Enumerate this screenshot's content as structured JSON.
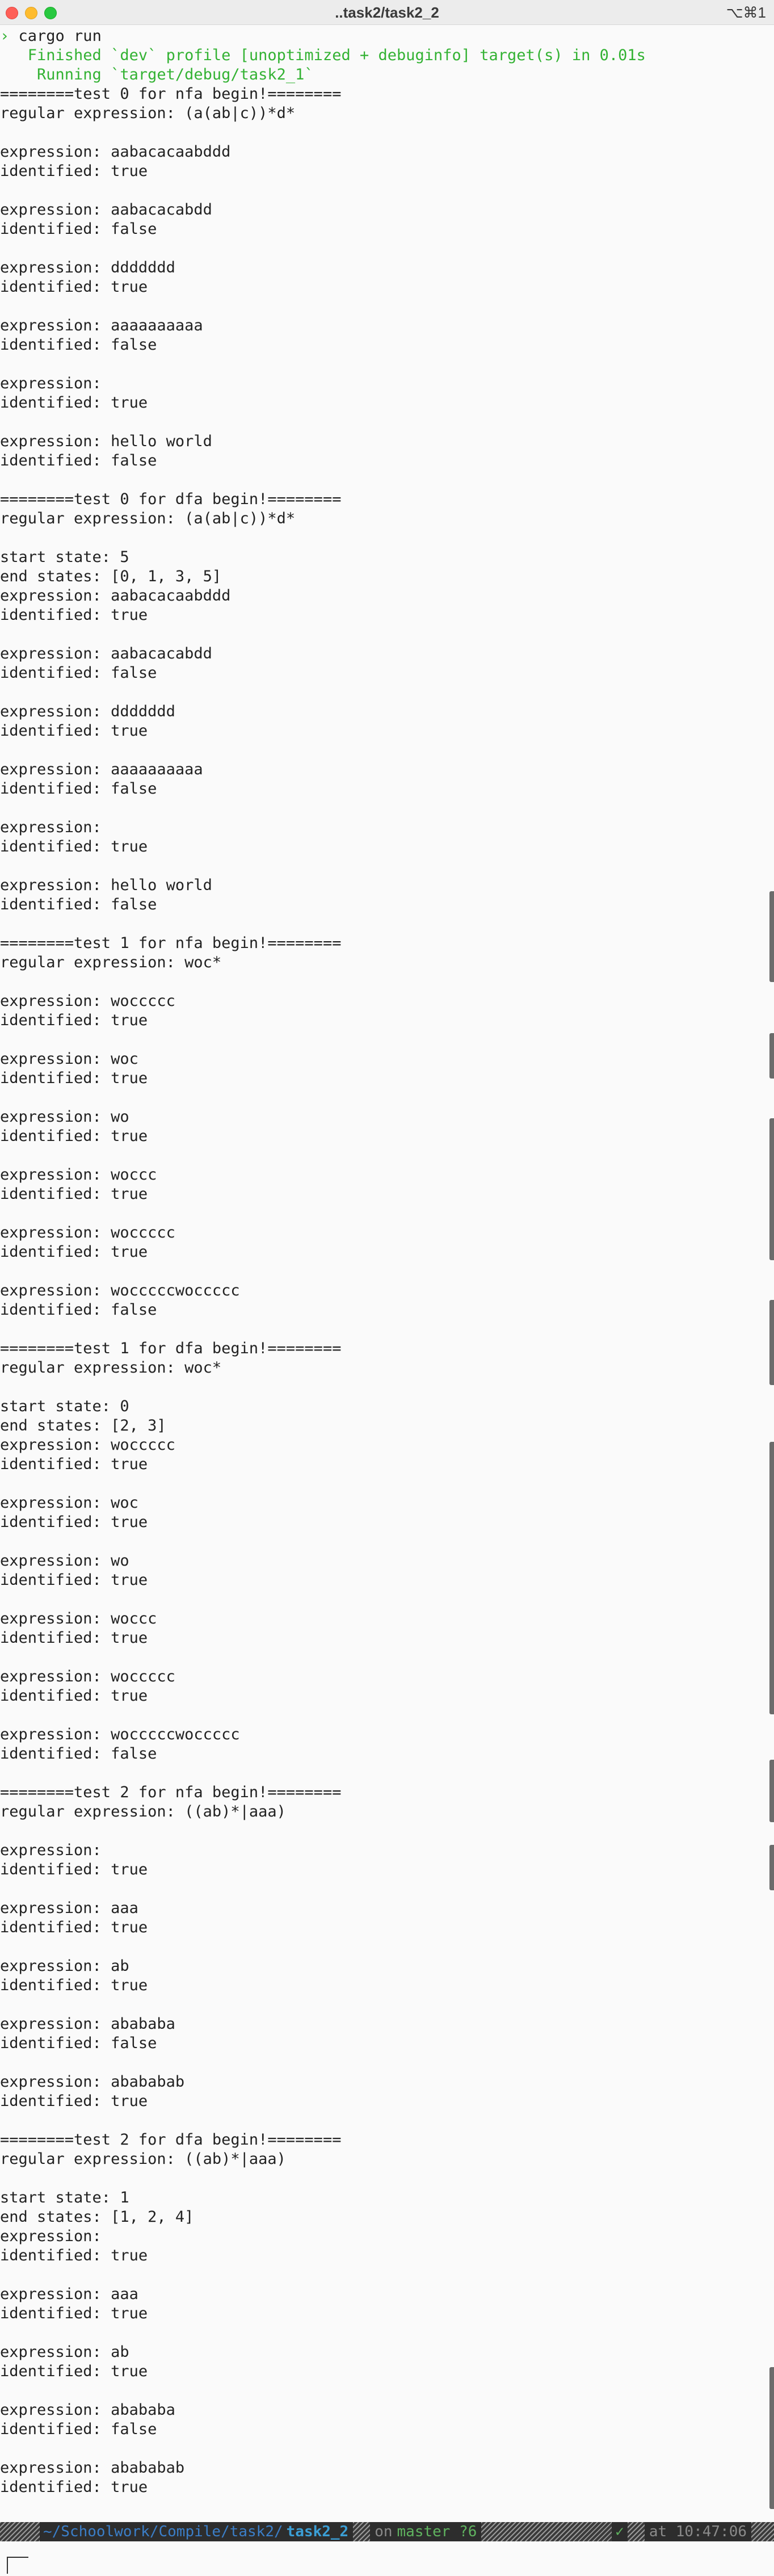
{
  "window": {
    "title": "..task2/task2_2",
    "shortcut": "⌥⌘1"
  },
  "terminal": {
    "lines": [
      {
        "text": "› cargo run",
        "tone": "prompt"
      },
      {
        "text": "   Finished `dev` profile [unoptimized + debuginfo] target(s) in 0.01s",
        "tone": "cargo"
      },
      {
        "text": "    Running `target/debug/task2_1`",
        "tone": "cargo"
      },
      {
        "text": "========test 0 for nfa begin!========"
      },
      {
        "text": "regular expression: (a(ab|c))*d*"
      },
      {
        "text": ""
      },
      {
        "text": "expression: aabacacaabddd"
      },
      {
        "text": "identified: true"
      },
      {
        "text": ""
      },
      {
        "text": "expression: aabacacabdd"
      },
      {
        "text": "identified: false"
      },
      {
        "text": ""
      },
      {
        "text": "expression: ddddddd"
      },
      {
        "text": "identified: true"
      },
      {
        "text": ""
      },
      {
        "text": "expression: aaaaaaaaaa"
      },
      {
        "text": "identified: false"
      },
      {
        "text": ""
      },
      {
        "text": "expression:"
      },
      {
        "text": "identified: true"
      },
      {
        "text": ""
      },
      {
        "text": "expression: hello world"
      },
      {
        "text": "identified: false"
      },
      {
        "text": ""
      },
      {
        "text": "========test 0 for dfa begin!========"
      },
      {
        "text": "regular expression: (a(ab|c))*d*"
      },
      {
        "text": ""
      },
      {
        "text": "start state: 5"
      },
      {
        "text": "end states: [0, 1, 3, 5]"
      },
      {
        "text": "expression: aabacacaabddd"
      },
      {
        "text": "identified: true"
      },
      {
        "text": ""
      },
      {
        "text": "expression: aabacacabdd"
      },
      {
        "text": "identified: false"
      },
      {
        "text": ""
      },
      {
        "text": "expression: ddddddd"
      },
      {
        "text": "identified: true"
      },
      {
        "text": ""
      },
      {
        "text": "expression: aaaaaaaaaa"
      },
      {
        "text": "identified: false"
      },
      {
        "text": ""
      },
      {
        "text": "expression:"
      },
      {
        "text": "identified: true"
      },
      {
        "text": ""
      },
      {
        "text": "expression: hello world"
      },
      {
        "text": "identified: false"
      },
      {
        "text": ""
      },
      {
        "text": "========test 1 for nfa begin!========"
      },
      {
        "text": "regular expression: woc*"
      },
      {
        "text": ""
      },
      {
        "text": "expression: woccccc"
      },
      {
        "text": "identified: true"
      },
      {
        "text": ""
      },
      {
        "text": "expression: woc"
      },
      {
        "text": "identified: true"
      },
      {
        "text": ""
      },
      {
        "text": "expression: wo"
      },
      {
        "text": "identified: true"
      },
      {
        "text": ""
      },
      {
        "text": "expression: woccc"
      },
      {
        "text": "identified: true"
      },
      {
        "text": ""
      },
      {
        "text": "expression: woccccc"
      },
      {
        "text": "identified: true"
      },
      {
        "text": ""
      },
      {
        "text": "expression: wocccccwoccccc"
      },
      {
        "text": "identified: false"
      },
      {
        "text": ""
      },
      {
        "text": "========test 1 for dfa begin!========"
      },
      {
        "text": "regular expression: woc*"
      },
      {
        "text": ""
      },
      {
        "text": "start state: 0"
      },
      {
        "text": "end states: [2, 3]"
      },
      {
        "text": "expression: woccccc"
      },
      {
        "text": "identified: true"
      },
      {
        "text": ""
      },
      {
        "text": "expression: woc"
      },
      {
        "text": "identified: true"
      },
      {
        "text": ""
      },
      {
        "text": "expression: wo"
      },
      {
        "text": "identified: true"
      },
      {
        "text": ""
      },
      {
        "text": "expression: woccc"
      },
      {
        "text": "identified: true"
      },
      {
        "text": ""
      },
      {
        "text": "expression: woccccc"
      },
      {
        "text": "identified: true"
      },
      {
        "text": ""
      },
      {
        "text": "expression: wocccccwoccccc"
      },
      {
        "text": "identified: false"
      },
      {
        "text": ""
      },
      {
        "text": "========test 2 for nfa begin!========"
      },
      {
        "text": "regular expression: ((ab)*|aaa)"
      },
      {
        "text": ""
      },
      {
        "text": "expression:"
      },
      {
        "text": "identified: true"
      },
      {
        "text": ""
      },
      {
        "text": "expression: aaa"
      },
      {
        "text": "identified: true"
      },
      {
        "text": ""
      },
      {
        "text": "expression: ab"
      },
      {
        "text": "identified: true"
      },
      {
        "text": ""
      },
      {
        "text": "expression: abababa"
      },
      {
        "text": "identified: false"
      },
      {
        "text": ""
      },
      {
        "text": "expression: abababab"
      },
      {
        "text": "identified: true"
      },
      {
        "text": ""
      },
      {
        "text": "========test 2 for dfa begin!========"
      },
      {
        "text": "regular expression: ((ab)*|aaa)"
      },
      {
        "text": ""
      },
      {
        "text": "start state: 1"
      },
      {
        "text": "end states: [1, 2, 4]"
      },
      {
        "text": "expression:"
      },
      {
        "text": "identified: true"
      },
      {
        "text": ""
      },
      {
        "text": "expression: aaa"
      },
      {
        "text": "identified: true"
      },
      {
        "text": ""
      },
      {
        "text": "expression: ab"
      },
      {
        "text": "identified: true"
      },
      {
        "text": ""
      },
      {
        "text": "expression: abababa"
      },
      {
        "text": "identified: false"
      },
      {
        "text": ""
      },
      {
        "text": "expression: abababab"
      },
      {
        "text": "identified: true"
      }
    ]
  },
  "statusbar": {
    "path": "~/Schoolwork/Compile/task2/",
    "dir": "task2_2",
    "on_label": "on",
    "branch": "master ?6",
    "check": "✓",
    "time": "at 10:47:06"
  },
  "colors": {
    "background": "#fafafa",
    "text": "#222222",
    "cargo_green": "#33b233",
    "statusbar_bg": "#2d2d2d",
    "path_blue": "#3b7ec8"
  }
}
